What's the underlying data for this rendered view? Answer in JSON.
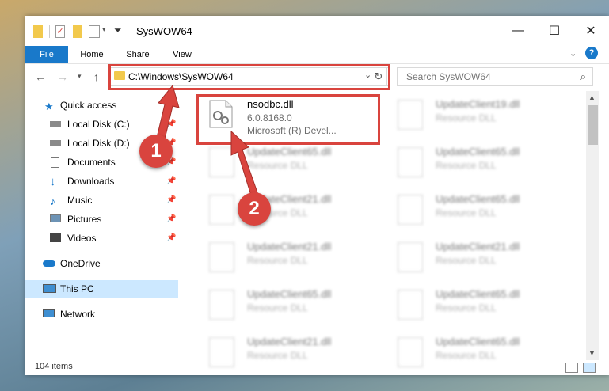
{
  "window": {
    "title": "SysWOW64"
  },
  "ribbon": {
    "tabs": [
      "File",
      "Home",
      "Share",
      "View"
    ],
    "help": "?"
  },
  "nav": {
    "address": "C:\\Windows\\SysWOW64",
    "search_placeholder": "Search SysWOW64"
  },
  "sidebar": {
    "items": [
      {
        "label": "Quick access",
        "icon": "star-icon",
        "pinned": false
      },
      {
        "label": "Local Disk (C:)",
        "icon": "drive-icon",
        "pinned": true
      },
      {
        "label": "Local Disk (D:)",
        "icon": "drive-icon",
        "pinned": true
      },
      {
        "label": "Documents",
        "icon": "documents-icon",
        "pinned": true
      },
      {
        "label": "Downloads",
        "icon": "download-icon",
        "pinned": true
      },
      {
        "label": "Music",
        "icon": "music-icon",
        "pinned": true
      },
      {
        "label": "Pictures",
        "icon": "pictures-icon",
        "pinned": true
      },
      {
        "label": "Videos",
        "icon": "videos-icon",
        "pinned": true
      },
      {
        "label": "OneDrive",
        "icon": "cloud-icon",
        "pinned": false
      },
      {
        "label": "This PC",
        "icon": "computer-icon",
        "pinned": false
      },
      {
        "label": "Network",
        "icon": "network-icon",
        "pinned": false
      }
    ]
  },
  "files": {
    "highlighted": {
      "name": "nsodbc.dll",
      "version": "6.0.8168.0",
      "company": "Microsoft (R) Devel..."
    },
    "others": [
      {
        "name": "UpdateClient19.dll",
        "type": "Resource DLL"
      },
      {
        "name": "UpdateClient65.dll",
        "type": "Resource DLL"
      },
      {
        "name": "UpdateClient65.dll",
        "type": "Resource DLL"
      },
      {
        "name": "UpdateClient21.dll",
        "type": "Resource DLL"
      },
      {
        "name": "UpdateClient65.dll",
        "type": "Resource DLL"
      },
      {
        "name": "UpdateClient21.dll",
        "type": "Resource DLL"
      },
      {
        "name": "UpdateClient21.dll",
        "type": "Resource DLL"
      },
      {
        "name": "UpdateClient65.dll",
        "type": "Resource DLL"
      },
      {
        "name": "UpdateClient65.dll",
        "type": "Resource DLL"
      },
      {
        "name": "UpdateClient21.dll",
        "type": "Resource DLL"
      },
      {
        "name": "UpdateClient65.dll",
        "type": "Resource DLL"
      }
    ]
  },
  "status": {
    "count": "104 items"
  },
  "annotations": {
    "badge1": "1",
    "badge2": "2",
    "color": "#d9443e"
  }
}
